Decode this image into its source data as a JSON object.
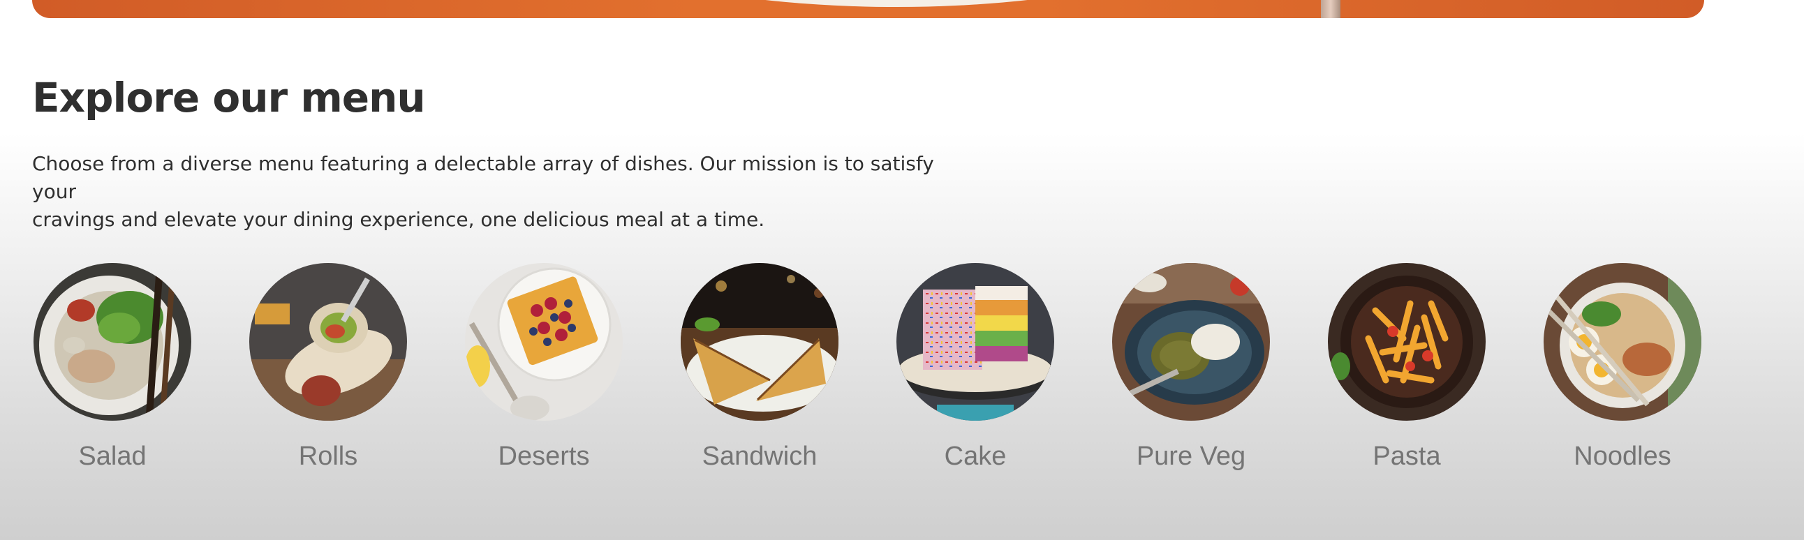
{
  "section": {
    "title": "Explore our menu",
    "description_line1": "Choose from a diverse menu featuring a delectable array of dishes. Our mission is to satisfy your",
    "description_line2": "cravings and elevate your dining experience, one delicious meal at a time."
  },
  "menu": [
    {
      "label": "Salad",
      "image": "salad-image"
    },
    {
      "label": "Rolls",
      "image": "rolls-image"
    },
    {
      "label": "Deserts",
      "image": "deserts-image"
    },
    {
      "label": "Sandwich",
      "image": "sandwich-image"
    },
    {
      "label": "Cake",
      "image": "cake-image"
    },
    {
      "label": "Pure Veg",
      "image": "pure-veg-image"
    },
    {
      "label": "Pasta",
      "image": "pasta-image"
    },
    {
      "label": "Noodles",
      "image": "noodles-image"
    }
  ],
  "colors": {
    "hero_accent": "#e2702e",
    "title_text": "#2f2f2f",
    "label_text": "#747474"
  }
}
